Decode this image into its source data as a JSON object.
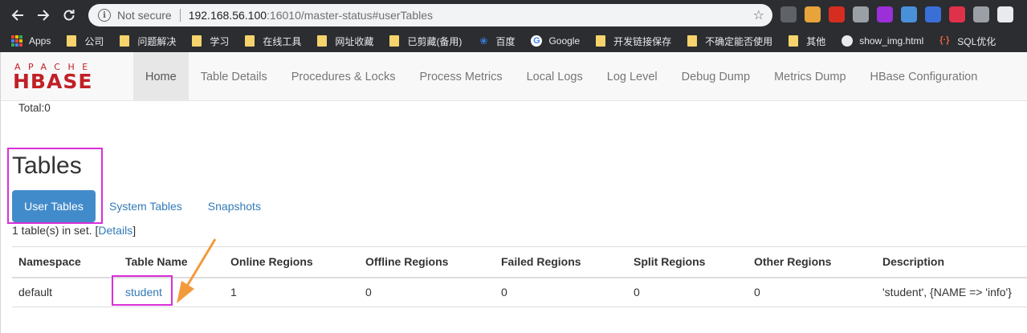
{
  "browser": {
    "security_label": "Not secure",
    "url_host": "192.168.56.100",
    "url_path": ":16010/master-status#userTables",
    "ext_icons": [
      "profile-icon",
      "owl-icon",
      "adblock-icon",
      "cursor-icon",
      "rp-icon",
      "circle-icon",
      "shield-icon",
      "pocket-icon",
      "cloud-icon",
      "glasses-icon"
    ],
    "ext_colors": [
      "#5f6368",
      "#e8a33b",
      "#d62d20",
      "#9aa0a6",
      "#9b2fd8",
      "#4a90d9",
      "#3b6fd8",
      "#e0314b",
      "#9aa0a6",
      "#e8eaed"
    ]
  },
  "bookmarks": [
    {
      "label": "Apps",
      "kind": "apps"
    },
    {
      "label": "公司",
      "kind": "folder"
    },
    {
      "label": "问题解决",
      "kind": "folder"
    },
    {
      "label": "学习",
      "kind": "folder"
    },
    {
      "label": "在线工具",
      "kind": "folder"
    },
    {
      "label": "网址收藏",
      "kind": "folder"
    },
    {
      "label": "已剪藏(备用)",
      "kind": "folder"
    },
    {
      "label": "百度",
      "kind": "baidu"
    },
    {
      "label": "Google",
      "kind": "google"
    },
    {
      "label": "开发链接保存",
      "kind": "folder"
    },
    {
      "label": "不确定能否使用",
      "kind": "folder"
    },
    {
      "label": "其他",
      "kind": "folder"
    },
    {
      "label": "show_img.html",
      "kind": "github"
    },
    {
      "label": "SQL优化",
      "kind": "sql"
    }
  ],
  "brand": {
    "top_text": "APACHE",
    "bottom_text": "HBASE",
    "color": "#c12026"
  },
  "nav": {
    "items": [
      "Home",
      "Table Details",
      "Procedures & Locks",
      "Process Metrics",
      "Local Logs",
      "Log Level",
      "Debug Dump",
      "Metrics Dump",
      "HBase Configuration"
    ],
    "active": "Home"
  },
  "total_text": "Total:0",
  "tables_section": {
    "heading": "Tables",
    "tabs": [
      "User Tables",
      "System Tables",
      "Snapshots"
    ],
    "count_prefix": "1 table(s) in set. [",
    "details_link": "Details",
    "count_suffix": "]"
  },
  "table": {
    "headers": [
      "Namespace",
      "Table Name",
      "Online Regions",
      "Offline Regions",
      "Failed Regions",
      "Split Regions",
      "Other Regions",
      "Description"
    ],
    "rows": [
      [
        "default",
        "student",
        "1",
        "0",
        "0",
        "0",
        "0",
        "'student', {NAME => 'info'}"
      ]
    ]
  },
  "colors": {
    "highlight": "#d82fd8",
    "arrow": "#f39a3c",
    "link": "#337ab7",
    "active_pill": "#428bca"
  }
}
